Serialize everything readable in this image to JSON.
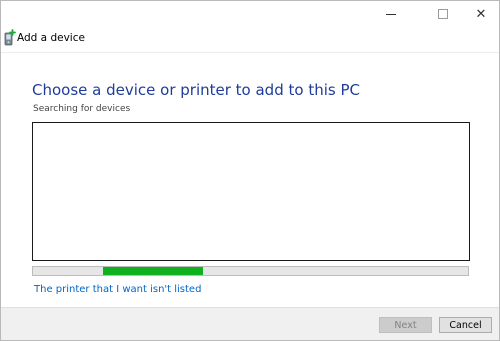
{
  "window": {
    "title": "Add a device",
    "minimize_icon": "minimize-icon",
    "maximize_icon": "maximize-icon",
    "close_glyph": "✕"
  },
  "main": {
    "heading": "Choose a device or printer to add to this PC",
    "status": "Searching for devices",
    "device_list": [],
    "progress": {
      "start_fraction": 0.16,
      "end_fraction": 0.39,
      "fill_color": "#0fb21e"
    },
    "link_text": "The printer that I want isn't listed"
  },
  "footer": {
    "next_label": "Next",
    "next_enabled": false,
    "cancel_label": "Cancel"
  },
  "colors": {
    "heading": "#1f3c9a",
    "link": "#0066cc"
  }
}
